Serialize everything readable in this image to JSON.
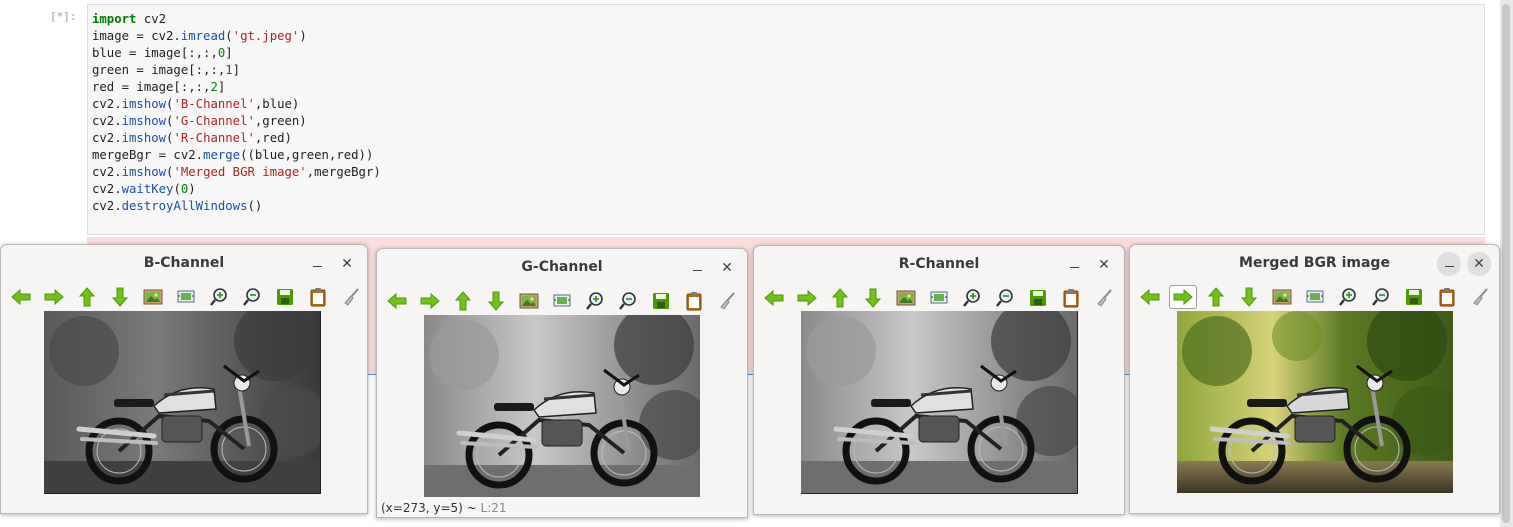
{
  "notebook": {
    "prompt": "[*]:",
    "code_lines": [
      [
        {
          "t": "import",
          "c": "kw"
        },
        {
          "t": " cv2",
          "c": ""
        }
      ],
      [
        {
          "t": "image = cv2.",
          "c": ""
        },
        {
          "t": "imread",
          "c": "fn"
        },
        {
          "t": "(",
          "c": ""
        },
        {
          "t": "'gt.jpeg'",
          "c": "str"
        },
        {
          "t": ")",
          "c": ""
        }
      ],
      [
        {
          "t": "blue = image[:,:,",
          "c": ""
        },
        {
          "t": "0",
          "c": "num"
        },
        {
          "t": "]",
          "c": ""
        }
      ],
      [
        {
          "t": "green = image[:,:,",
          "c": ""
        },
        {
          "t": "1",
          "c": "num"
        },
        {
          "t": "]",
          "c": ""
        }
      ],
      [
        {
          "t": "red = image[:,:,",
          "c": ""
        },
        {
          "t": "2",
          "c": "num"
        },
        {
          "t": "]",
          "c": ""
        }
      ],
      [
        {
          "t": "cv2.",
          "c": ""
        },
        {
          "t": "imshow",
          "c": "fn"
        },
        {
          "t": "(",
          "c": ""
        },
        {
          "t": "'B-Channel'",
          "c": "str"
        },
        {
          "t": ",blue)",
          "c": ""
        }
      ],
      [
        {
          "t": "cv2.",
          "c": ""
        },
        {
          "t": "imshow",
          "c": "fn"
        },
        {
          "t": "(",
          "c": ""
        },
        {
          "t": "'G-Channel'",
          "c": "str"
        },
        {
          "t": ",green)",
          "c": ""
        }
      ],
      [
        {
          "t": "cv2.",
          "c": ""
        },
        {
          "t": "imshow",
          "c": "fn"
        },
        {
          "t": "(",
          "c": ""
        },
        {
          "t": "'R-Channel'",
          "c": "str"
        },
        {
          "t": ",red)",
          "c": ""
        }
      ],
      [
        {
          "t": "mergeBgr = cv2.",
          "c": ""
        },
        {
          "t": "merge",
          "c": "fn"
        },
        {
          "t": "((blue,green,red))",
          "c": ""
        }
      ],
      [
        {
          "t": "cv2.",
          "c": ""
        },
        {
          "t": "imshow",
          "c": "fn"
        },
        {
          "t": "(",
          "c": ""
        },
        {
          "t": "'Merged BGR image'",
          "c": "str"
        },
        {
          "t": ",mergeBgr)",
          "c": ""
        }
      ],
      [
        {
          "t": "cv2.",
          "c": ""
        },
        {
          "t": "waitKey",
          "c": "fn"
        },
        {
          "t": "(",
          "c": ""
        },
        {
          "t": "0",
          "c": "num"
        },
        {
          "t": ")",
          "c": ""
        }
      ],
      [
        {
          "t": "cv2.",
          "c": ""
        },
        {
          "t": "destroyAllWindows",
          "c": "fn"
        },
        {
          "t": "()",
          "c": ""
        }
      ]
    ]
  },
  "windows": {
    "b": {
      "title": "B-Channel"
    },
    "g": {
      "title": "G-Channel",
      "status": "(x=273, y=5) ~",
      "status_level": "L:21"
    },
    "r": {
      "title": "R-Channel"
    },
    "m": {
      "title": "Merged BGR image"
    }
  },
  "toolbar_icons": [
    "arrow-left-icon",
    "arrow-right-icon",
    "arrow-up-icon",
    "arrow-down-icon",
    "image-icon",
    "zoom-fit-icon",
    "zoom-in-icon",
    "zoom-out-icon",
    "save-icon",
    "clipboard-icon",
    "broom-icon"
  ],
  "colors": {
    "icon_green": "#4e9a06",
    "icon_green_light": "#73c01d"
  }
}
